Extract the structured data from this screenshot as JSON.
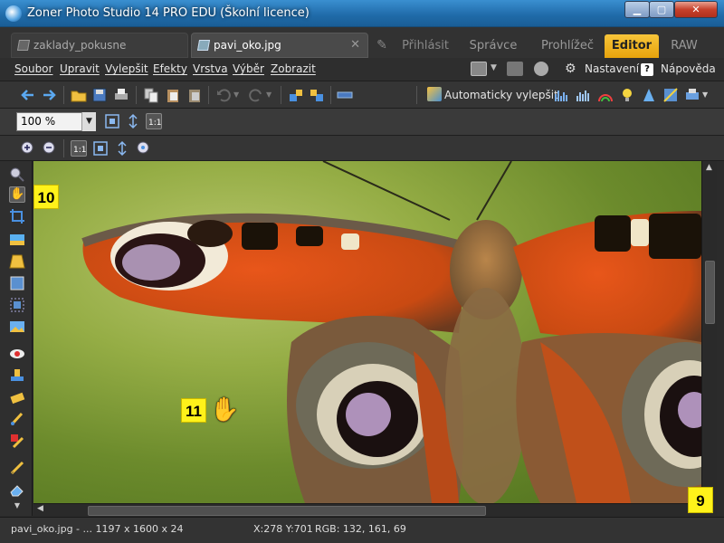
{
  "window": {
    "title": "Zoner Photo Studio 14 PRO EDU (Školní licence)",
    "minimize": "▁",
    "maximize": "▢",
    "close": "✕"
  },
  "tabs": {
    "documents": [
      {
        "label": "zaklady_pokusne",
        "active": false
      },
      {
        "label": "pavi_oko.jpg",
        "active": true
      }
    ],
    "close_glyph": "✕",
    "modules": [
      {
        "label": "Přihlásit"
      },
      {
        "label": "Správce"
      },
      {
        "label": "Prohlížeč"
      },
      {
        "label": "Editor",
        "active": true
      },
      {
        "label": "RAW"
      }
    ]
  },
  "menu": {
    "items": [
      "Soubor",
      "Upravit",
      "Vylepšit",
      "Efekty",
      "Vrstva",
      "Výběr",
      "Zobrazit"
    ],
    "settings": "Nastavení",
    "help": "Nápověda",
    "help_icon": "?"
  },
  "toolbar": {
    "auto_enhance": "Automaticky vylepšit",
    "zoom_value": "100 %",
    "zoom_arrow": "▼"
  },
  "icons": {
    "gear": "⚙",
    "hand": "✋",
    "dropdown": "▼"
  },
  "markers": {
    "m10": "10",
    "m11": "11",
    "m9": "9"
  },
  "status": {
    "file": "pavi_oko.jpg - ... 1197 x 1600 x 24",
    "coords": "X:278 Y:701",
    "rgb": "RGB: 132, 161, 69"
  },
  "colors": {
    "accent": "#e7a30c",
    "title_bar": "#1f6aa8",
    "marker": "#fff21a"
  }
}
